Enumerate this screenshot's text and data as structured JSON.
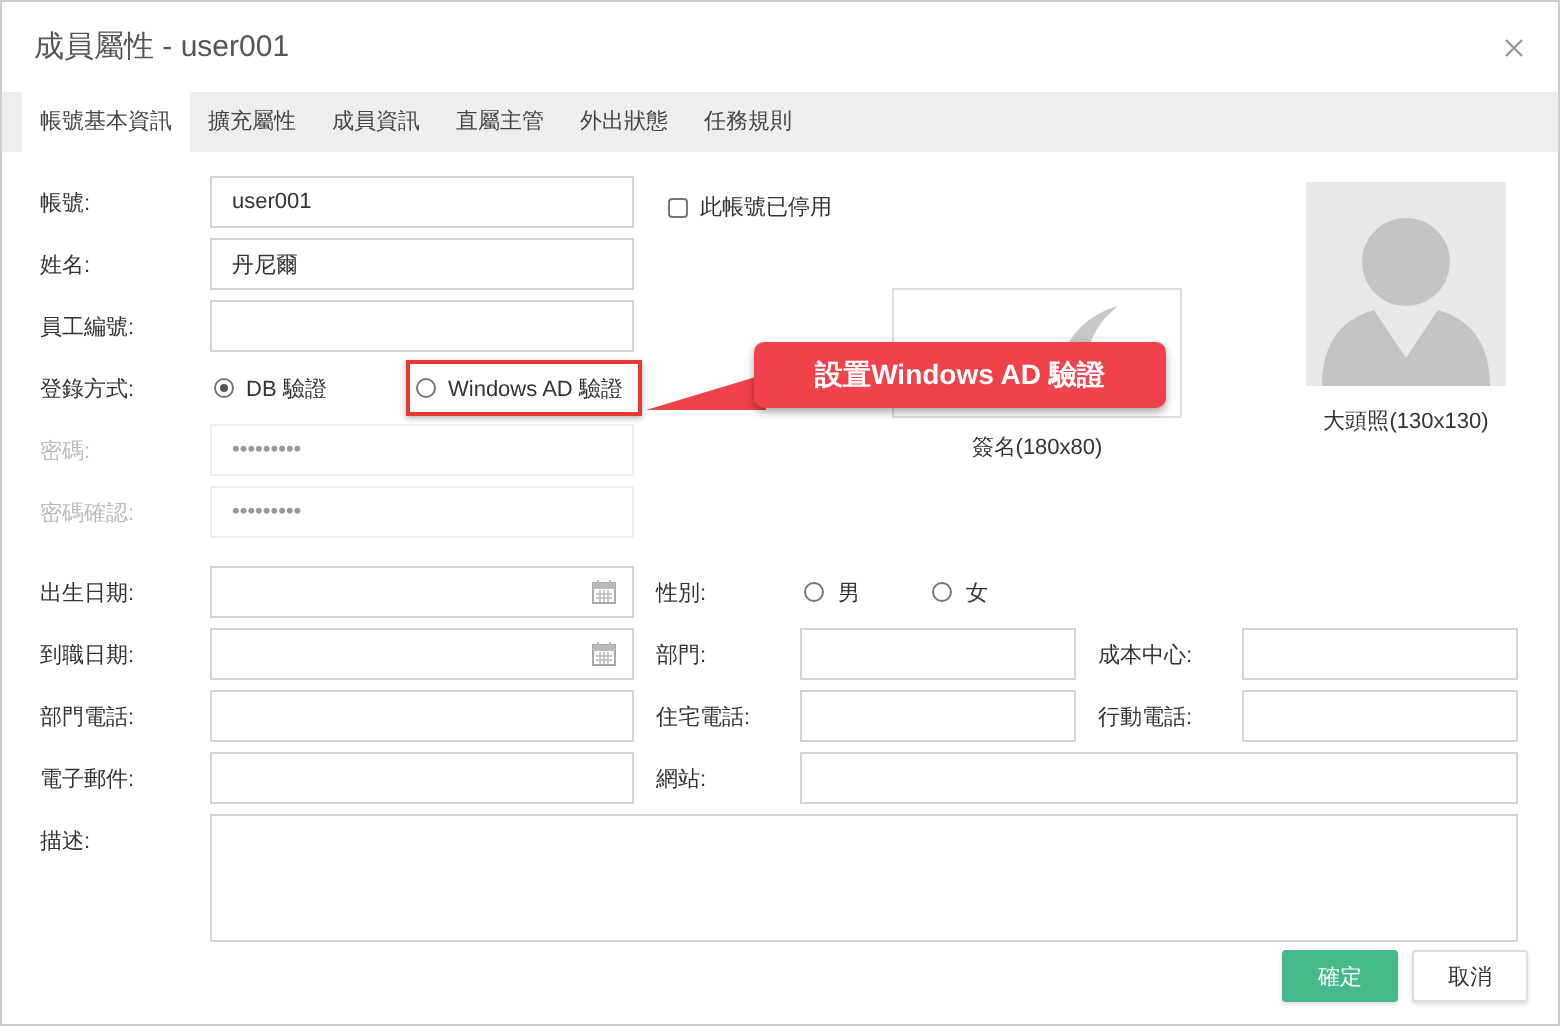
{
  "window": {
    "title": "成員屬性 - user001"
  },
  "tabs": [
    {
      "label": "帳號基本資訊",
      "selected": true
    },
    {
      "label": "擴充屬性",
      "selected": false
    },
    {
      "label": "成員資訊",
      "selected": false
    },
    {
      "label": "直屬主管",
      "selected": false
    },
    {
      "label": "外出狀態",
      "selected": false
    },
    {
      "label": "任務規則",
      "selected": false
    }
  ],
  "account_fields": [
    {
      "label": "帳號:",
      "kind": "text",
      "value": "user001",
      "disabled": false
    },
    {
      "label": "姓名:",
      "kind": "text",
      "value": "丹尼爾",
      "disabled": false
    },
    {
      "label": "員工編號:",
      "kind": "text",
      "disabled": false
    },
    {
      "label": "登錄方式:",
      "kind": "radio",
      "disabled": false,
      "options": [
        {
          "label": "DB 驗證",
          "selected": true,
          "highlighted": false
        },
        {
          "label": "Windows AD 驗證",
          "selected": false,
          "highlighted": true
        }
      ]
    },
    {
      "label": "密碼:",
      "kind": "text",
      "value": "•••••••••",
      "disabled": true
    },
    {
      "label": "密碼確認:",
      "kind": "text",
      "value": "•••••••••",
      "disabled": true
    }
  ],
  "disabled_checkbox": {
    "label": "此帳號已停用",
    "checked": false
  },
  "signature": {
    "caption": "簽名(180x80)"
  },
  "photo": {
    "caption": "大頭照(130x130)"
  },
  "detail_fields": [
    {
      "label": "出生日期:",
      "kind": "date"
    },
    {
      "label": "性別:",
      "kind": "radio",
      "options": [
        {
          "label": "男",
          "selected": false
        },
        {
          "label": "女",
          "selected": false
        }
      ]
    },
    {
      "label": "到職日期:",
      "kind": "date"
    },
    {
      "label": "部門:",
      "kind": "text"
    },
    {
      "label": "成本中心:",
      "kind": "text"
    },
    {
      "label": "部門電話:",
      "kind": "text"
    },
    {
      "label": "住宅電話:",
      "kind": "text"
    },
    {
      "label": "行動電話:",
      "kind": "text"
    },
    {
      "label": "電子郵件:",
      "kind": "text"
    },
    {
      "label": "網站:",
      "kind": "wide"
    },
    {
      "label": "描述:",
      "kind": "textarea"
    }
  ],
  "buttons": [
    {
      "label": "確定",
      "kind": "primary"
    },
    {
      "label": "取消",
      "kind": "default"
    }
  ],
  "callout": {
    "text": "設置Windows AD 驗證"
  }
}
